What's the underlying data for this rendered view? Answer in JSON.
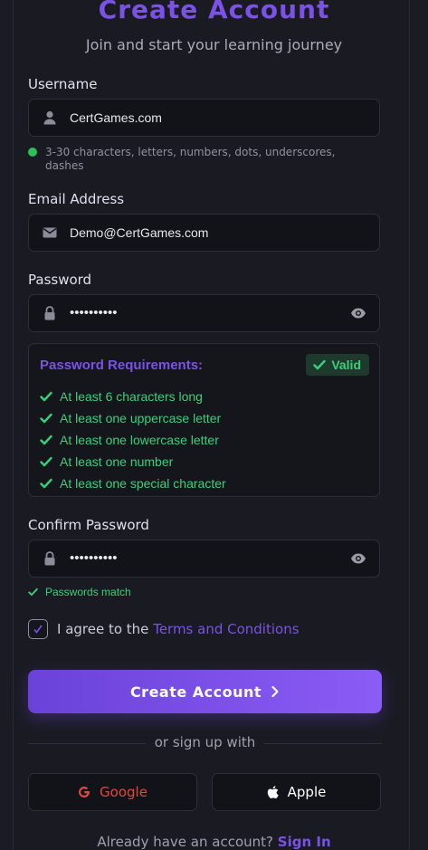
{
  "header": {
    "title": "Create Account",
    "subtitle": "Join and start your learning journey"
  },
  "username": {
    "label": "Username",
    "value": "CertGames.com",
    "icon": "user-icon",
    "hint": "3-30 characters, letters, numbers, dots, underscores, dashes"
  },
  "email": {
    "label": "Email Address",
    "value": "Demo@CertGames.com",
    "icon": "envelope-icon"
  },
  "password": {
    "label": "Password",
    "masked_value": "••••••••••",
    "icon": "lock-icon",
    "toggle_icon": "eye-icon"
  },
  "requirements": {
    "title": "Password Requirements:",
    "status": "Valid",
    "items": [
      "At least 6 characters long",
      "At least one uppercase letter",
      "At least one lowercase letter",
      "At least one number",
      "At least one special character"
    ]
  },
  "confirm": {
    "label": "Confirm Password",
    "masked_value": "••••••••••",
    "icon": "lock-icon",
    "toggle_icon": "eye-icon",
    "match_text": "Passwords match"
  },
  "terms": {
    "prefix": "I agree to the",
    "link": "Terms and Conditions",
    "checked": true
  },
  "submit": {
    "label": "Create Account"
  },
  "divider": {
    "text": "or sign up with"
  },
  "social": {
    "google_label": "Google",
    "apple_label": "Apple"
  },
  "footer": {
    "prompt": "Already have an account?",
    "link": "Sign In"
  },
  "colors": {
    "accent": "#7b52e6",
    "success": "#3ad07a",
    "google": "#e04a3c",
    "background": "#1a1b22"
  }
}
